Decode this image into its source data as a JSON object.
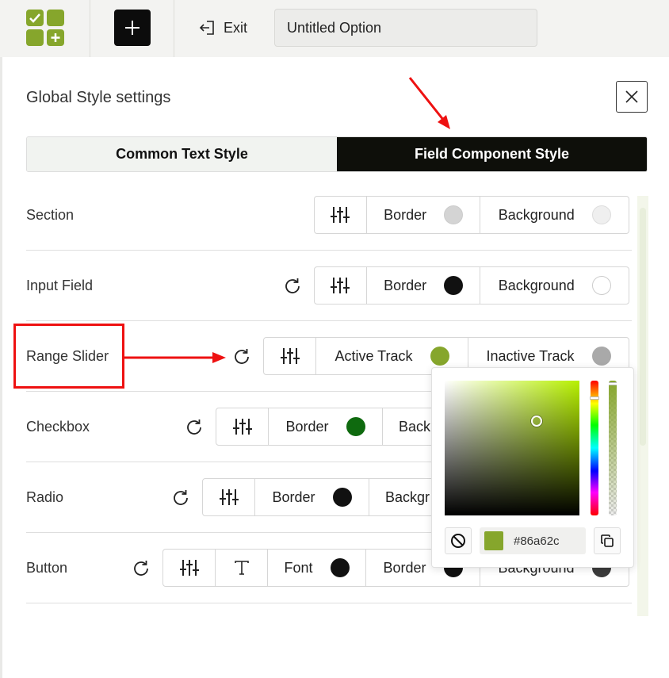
{
  "topbar": {
    "exit_label": "Exit",
    "title_value": "Untitled Option"
  },
  "panel": {
    "title": "Global Style settings",
    "tabs": [
      {
        "label": "Common Text Style",
        "active": false
      },
      {
        "label": "Field Component Style",
        "active": true
      }
    ]
  },
  "rows": {
    "section": {
      "label": "Section",
      "controls": [
        {
          "label": "Border",
          "color": "#d4d4d4"
        },
        {
          "label": "Background",
          "color": "#efefef"
        }
      ]
    },
    "input_field": {
      "label": "Input Field",
      "controls": [
        {
          "label": "Border",
          "color": "#111111"
        },
        {
          "label": "Background",
          "color": "#ffffff"
        }
      ]
    },
    "range_slider": {
      "label": "Range Slider",
      "controls": [
        {
          "label": "Active Track",
          "color": "#86a62c"
        },
        {
          "label": "Inactive Track",
          "color": "#a9a9a9"
        }
      ]
    },
    "checkbox": {
      "label": "Checkbox",
      "controls": [
        {
          "label": "Border",
          "color": "#0f6a0f"
        },
        {
          "label": "Back",
          "color": "#ffffff"
        }
      ]
    },
    "radio": {
      "label": "Radio",
      "controls": [
        {
          "label": "Border",
          "color": "#111111"
        },
        {
          "label": "Backgr",
          "color": "#ffffff"
        }
      ]
    },
    "button": {
      "label": "Button",
      "controls": [
        {
          "label": "Font",
          "color": "#111111"
        },
        {
          "label": "Border",
          "color": "#111111"
        },
        {
          "label": "Background",
          "color": "#3c3c3c"
        }
      ]
    }
  },
  "color_picker": {
    "hex_value": "#86a62c",
    "selected_color": "#86a62c"
  },
  "colors": {
    "brand_green": "#86a62c",
    "active_tab_bg": "#0e0f0a",
    "annotation_red": "#ee1111"
  },
  "icons": [
    "plus-icon",
    "exit-icon",
    "close-icon",
    "sliders-icon",
    "reset-icon",
    "text-icon",
    "no-color-icon",
    "copy-icon"
  ]
}
